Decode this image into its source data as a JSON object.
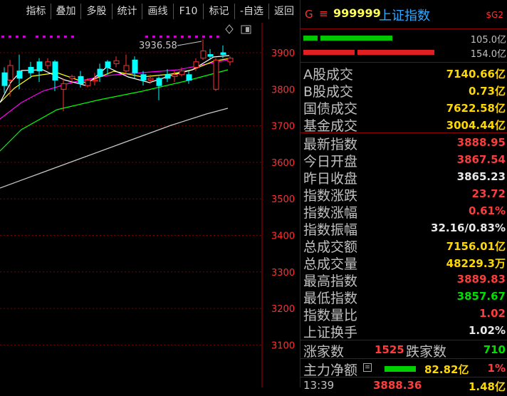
{
  "toolbar": {
    "buttons": [
      "指标",
      "叠加",
      "多股",
      "统计",
      "画线",
      "F10",
      "标记",
      "-自选",
      "返回"
    ]
  },
  "chart": {
    "y_axis_labels": [
      "3900",
      "3800",
      "3700",
      "3600",
      "3500",
      "3400",
      "3300",
      "3200",
      "3100"
    ],
    "high_annotation": "3936.58",
    "colors": {
      "up": "#ff3232",
      "down": "#00ffff",
      "ma5": "#ffffff",
      "ma10": "#ffff00",
      "ma20": "#ff00ff",
      "ma60": "#00ff00",
      "ma120": "#c8c8c8"
    }
  },
  "header": {
    "g_label": "G",
    "menu_icon": "hamburger-icon",
    "code": "999999",
    "name": "上证指数",
    "sg_badge": "$G2"
  },
  "bars": {
    "top_value": "105.0亿",
    "bottom_value": "154.0亿"
  },
  "turnover": [
    {
      "label": "A股成交",
      "value": "7140.66亿",
      "color": "yellow"
    },
    {
      "label": "B股成交",
      "value": "0.73亿",
      "color": "yellow"
    },
    {
      "label": "国债成交",
      "value": "7622.58亿",
      "color": "yellow"
    },
    {
      "label": "基金成交",
      "value": "3004.44亿",
      "color": "yellow"
    }
  ],
  "quote": [
    {
      "label": "最新指数",
      "value": "3888.95",
      "color": "red"
    },
    {
      "label": "今日开盘",
      "value": "3867.54",
      "color": "red"
    },
    {
      "label": "昨日收盘",
      "value": "3865.23",
      "color": "white"
    },
    {
      "label": "指数涨跌",
      "value": "23.72",
      "color": "red"
    },
    {
      "label": "指数涨幅",
      "value": "0.61%",
      "color": "red"
    },
    {
      "label": "指数振幅",
      "value": "32.16/0.83%",
      "color": "white"
    },
    {
      "label": "总成交额",
      "value": "7156.01亿",
      "color": "yellow"
    },
    {
      "label": "总成交量",
      "value": "48229.3万",
      "color": "yellow"
    },
    {
      "label": "最高指数",
      "value": "3889.83",
      "color": "red"
    },
    {
      "label": "最低指数",
      "value": "3857.67",
      "color": "green"
    },
    {
      "label": "指数量比",
      "value": "1.02",
      "color": "red"
    },
    {
      "label": "上证换手",
      "value": "1.02%",
      "color": "white"
    }
  ],
  "breadth": {
    "up_label": "涨家数",
    "up_count": "1525",
    "down_label": "跌家数",
    "down_count": "710"
  },
  "mainflow": {
    "label": "主力净额",
    "value": "82.82亿",
    "pct": "1%"
  },
  "tick": {
    "time": "13:39",
    "price": "3888.36",
    "vol": "1.48亿"
  }
}
